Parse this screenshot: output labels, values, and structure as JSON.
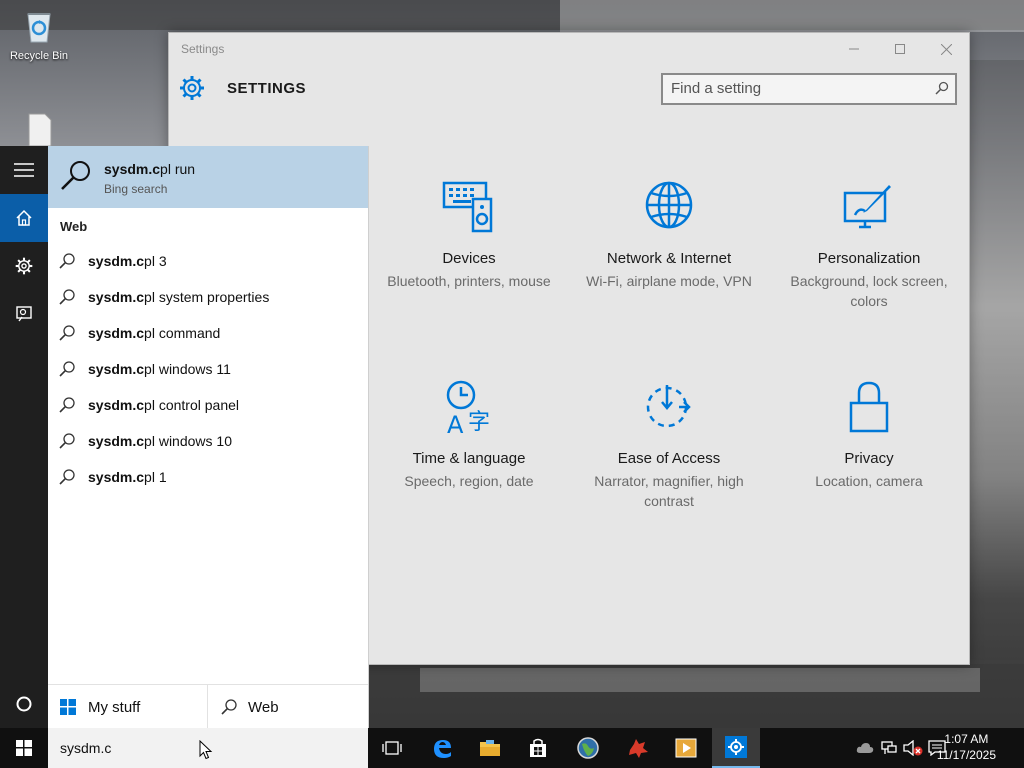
{
  "desktop": {
    "icons": [
      {
        "label": "Recycle Bin",
        "icon": "recycle-bin-icon"
      }
    ]
  },
  "settings_window": {
    "title": "Settings",
    "header": "SETTINGS",
    "search_placeholder": "Find a setting",
    "tiles": [
      {
        "name": "Devices",
        "desc": "Bluetooth, printers, mouse",
        "icon": "devices-icon"
      },
      {
        "name": "Network & Internet",
        "desc": "Wi-Fi, airplane mode, VPN",
        "icon": "globe-icon"
      },
      {
        "name": "Personalization",
        "desc": "Background, lock screen, colors",
        "icon": "personalization-icon"
      },
      {
        "name": "Time & language",
        "desc": "Speech, region, date",
        "icon": "time-language-icon"
      },
      {
        "name": "Ease of Access",
        "desc": "Narrator, magnifier, high contrast",
        "icon": "ease-of-access-icon"
      },
      {
        "name": "Privacy",
        "desc": "Location, camera",
        "icon": "lock-icon"
      }
    ]
  },
  "search_panel": {
    "best_match": {
      "title_bold": "sysdm.c",
      "title_rest": "pl run",
      "subtitle": "Bing search"
    },
    "section": "Web",
    "suggestions": [
      {
        "bold": "sysdm.c",
        "rest": "pl 3"
      },
      {
        "bold": "sysdm.c",
        "rest": "pl system properties"
      },
      {
        "bold": "sysdm.c",
        "rest": "pl command"
      },
      {
        "bold": "sysdm.c",
        "rest": "pl windows 11"
      },
      {
        "bold": "sysdm.c",
        "rest": "pl control panel"
      },
      {
        "bold": "sysdm.c",
        "rest": "pl windows 10"
      },
      {
        "bold": "sysdm.c",
        "rest": "pl 1"
      }
    ],
    "footer": {
      "my_stuff": "My stuff",
      "web": "Web"
    }
  },
  "taskbar": {
    "search_value": "sysdm.c",
    "clock_time": "1:07 AM",
    "clock_date": "11/17/2025"
  },
  "colors": {
    "accent": "#0078d7",
    "best_match_bg": "#b9d2e6",
    "rail_bg": "#1f1f1f",
    "taskbar_bg": "#101010"
  }
}
